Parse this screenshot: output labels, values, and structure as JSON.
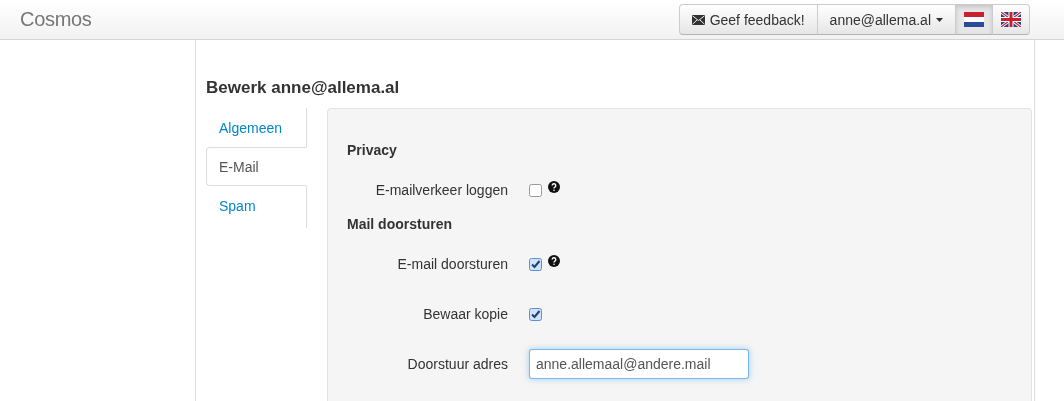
{
  "navbar": {
    "brand": "Cosmos",
    "feedback_button": "Geef feedback!",
    "user_menu": "anne@allema.al",
    "languages": [
      {
        "kind": "nl",
        "selected": true
      },
      {
        "kind": "gb",
        "selected": false
      }
    ]
  },
  "heading": "Bewerk anne@allema.al",
  "tabs": [
    {
      "label": "Algemeen",
      "selected": false
    },
    {
      "label": "E-Mail",
      "selected": true
    },
    {
      "label": "Spam",
      "selected": false
    }
  ],
  "sections": [
    {
      "title": "Privacy",
      "fields": [
        {
          "kind": "checkbox",
          "label": "E-mailverkeer loggen",
          "checked": false,
          "help": true
        }
      ]
    },
    {
      "title": "Mail doorsturen",
      "fields": [
        {
          "kind": "checkbox",
          "label": "E-mail doorsturen",
          "checked": true,
          "help": true
        },
        {
          "kind": "checkbox",
          "label": "Bewaar kopie",
          "checked": true,
          "help": false
        },
        {
          "kind": "text",
          "label": "Doorstuur adres",
          "value": "anne.allemaal@andere.mail"
        }
      ]
    }
  ]
}
